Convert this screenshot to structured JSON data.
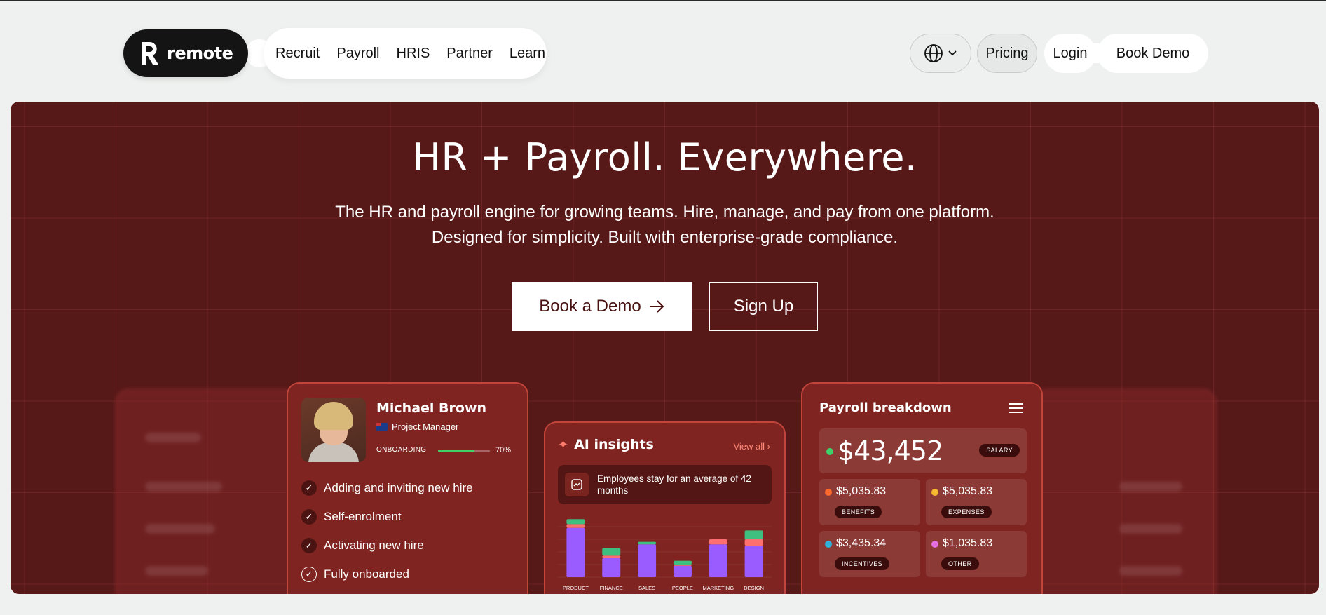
{
  "nav": {
    "logo_text": "remote",
    "items": [
      "Recruit",
      "Payroll",
      "HRIS",
      "Partner",
      "Learn"
    ],
    "pricing": "Pricing",
    "login": "Login",
    "book_demo": "Book Demo"
  },
  "hero": {
    "title": "HR + Payroll. Everywhere.",
    "subtitle_line1": "The HR and payroll engine for growing teams. Hire, manage, and pay from one platform.",
    "subtitle_line2": "Designed for simplicity. Built with enterprise-grade compliance.",
    "cta_primary": "Book a Demo",
    "cta_secondary": "Sign Up"
  },
  "onboarding_card": {
    "name": "Michael Brown",
    "role": "Project Manager",
    "progress_label": "ONBOARDING",
    "progress_text": "70%",
    "progress_value": 0.7,
    "steps": [
      {
        "label": "Adding and inviting new hire",
        "done": true
      },
      {
        "label": "Self-enrolment",
        "done": true
      },
      {
        "label": "Activating new hire",
        "done": true
      },
      {
        "label": "Fully onboarded",
        "done": false
      }
    ]
  },
  "ai_card": {
    "title": "AI insights",
    "view_all": "View all",
    "note": "Employees stay for an average of 42 months",
    "categories": [
      "PRODUCT",
      "FINANCE",
      "SALES",
      "PEOPLE",
      "MARKETING",
      "DESIGN"
    ],
    "series": [
      {
        "color": "#9b5cff",
        "values": [
          78,
          30,
          52,
          18,
          52,
          50
        ]
      },
      {
        "color": "#ff6f6f",
        "values": [
          6,
          4,
          0,
          2,
          8,
          10
        ]
      },
      {
        "color": "#3fbf7f",
        "values": [
          8,
          12,
          4,
          6,
          0,
          14
        ]
      }
    ]
  },
  "payroll_card": {
    "title": "Payroll breakdown",
    "salary": "$43,452",
    "salary_tag": "SALARY",
    "items": [
      {
        "amount": "$5,035.83",
        "tag": "BENEFITS",
        "color": "#ff6a2a"
      },
      {
        "amount": "$5,035.83",
        "tag": "EXPENSES",
        "color": "#f5b82e"
      },
      {
        "amount": "$3,435.34",
        "tag": "INCENTIVES",
        "color": "#2fb5d9"
      },
      {
        "amount": "$1,035.83",
        "tag": "OTHER",
        "color": "#e36ee0"
      }
    ]
  }
}
